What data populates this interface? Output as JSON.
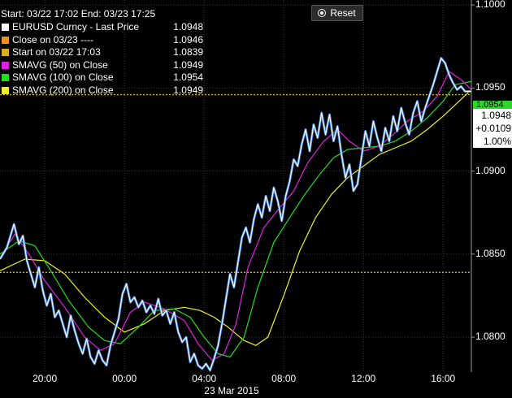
{
  "header": {
    "range_text": "Start: 03/22 17:02 End: 03/23 17:25",
    "reset_label": "Reset"
  },
  "legend": [
    {
      "label": "EURUSD Curncy - Last Price",
      "value": "1.0948",
      "color": "#ffffff"
    },
    {
      "label": "Close on 03/23 ----",
      "value": "1.0946",
      "color": "#f28c1c"
    },
    {
      "label": "Start on 03/22 17:03",
      "value": "1.0839",
      "color": "#d4b020"
    },
    {
      "label": "SMAVG (50) on Close",
      "value": "1.0949",
      "color": "#e020e0"
    },
    {
      "label": "SMAVG (100) on Close",
      "value": "1.0954",
      "color": "#20dd20"
    },
    {
      "label": "SMAVG (200) on Close",
      "value": "1.0949",
      "color": "#f0f020"
    }
  ],
  "last_price_box": {
    "ma_value": "1.0954",
    "price": "1.0948",
    "change": "+0.0109",
    "pct": "1.00%"
  },
  "chart_data": {
    "type": "line",
    "title": "",
    "xlabel": "23 Mar 2015",
    "ylabel": "",
    "x_range_hours": [
      -6.25,
      17.42
    ],
    "x_ticks": [
      {
        "label": "20:00",
        "hour": -4
      },
      {
        "label": "00:00",
        "hour": 0
      },
      {
        "label": "04:00",
        "hour": 4
      },
      {
        "label": "08:00",
        "hour": 8
      },
      {
        "label": "12:00",
        "hour": 12
      },
      {
        "label": "16:00",
        "hour": 16
      }
    ],
    "ylim": [
      1.0779,
      1.1003
    ],
    "y_ticks": [
      "1.1000",
      "1.0950",
      "1.0900",
      "1.0850",
      "1.0800"
    ],
    "reference_lines": [
      {
        "name": "Close on 03/23",
        "value": 1.0946,
        "color": "#d4b020"
      },
      {
        "name": "Start on 03/22 17:03",
        "value": 1.0839,
        "color": "#d4b020"
      }
    ],
    "series": [
      {
        "name": "EURUSD Curncy - Last Price",
        "color": "#ffffff",
        "x": [
          -6.25,
          -5.9,
          -5.7,
          -5.55,
          -5.3,
          -5.1,
          -4.9,
          -4.7,
          -4.5,
          -4.3,
          -4.1,
          -3.9,
          -3.7,
          -3.5,
          -3.3,
          -3.1,
          -2.9,
          -2.7,
          -2.5,
          -2.3,
          -2.1,
          -1.9,
          -1.7,
          -1.5,
          -1.3,
          -1.1,
          -0.9,
          -0.7,
          -0.5,
          -0.3,
          -0.1,
          0.1,
          0.3,
          0.5,
          0.7,
          0.9,
          1.1,
          1.3,
          1.5,
          1.7,
          1.9,
          2.1,
          2.3,
          2.5,
          2.7,
          2.9,
          3.1,
          3.3,
          3.5,
          3.7,
          3.9,
          4.1,
          4.3,
          4.5,
          4.7,
          4.9,
          5.1,
          5.3,
          5.5,
          5.7,
          5.9,
          6.1,
          6.3,
          6.5,
          6.7,
          6.9,
          7.1,
          7.3,
          7.5,
          7.7,
          7.9,
          8.1,
          8.3,
          8.5,
          8.7,
          8.9,
          9.1,
          9.3,
          9.5,
          9.7,
          9.9,
          10.1,
          10.3,
          10.5,
          10.7,
          10.9,
          11.1,
          11.3,
          11.5,
          11.7,
          11.9,
          12.1,
          12.3,
          12.5,
          12.7,
          12.9,
          13.1,
          13.3,
          13.5,
          13.7,
          13.9,
          14.1,
          14.3,
          14.5,
          14.7,
          14.9,
          15.1,
          15.3,
          15.5,
          15.7,
          15.9,
          16.1,
          16.3,
          16.5,
          16.7,
          16.9,
          17.1,
          17.42
        ],
        "values": [
          1.0847,
          1.0854,
          1.0862,
          1.0868,
          1.0856,
          1.0861,
          1.0846,
          1.0838,
          1.083,
          1.0842,
          1.0828,
          1.0819,
          1.0826,
          1.0812,
          1.0816,
          1.0808,
          1.08,
          1.0813,
          1.0804,
          1.0796,
          1.079,
          1.0799,
          1.0788,
          1.0784,
          1.0792,
          1.0786,
          1.0783,
          1.0795,
          1.0803,
          1.0811,
          1.0826,
          1.0832,
          1.0821,
          1.0824,
          1.0818,
          1.0822,
          1.0815,
          1.0819,
          1.0814,
          1.0823,
          1.0813,
          1.0816,
          1.0808,
          1.0815,
          1.0803,
          1.0797,
          1.08,
          1.0785,
          1.079,
          1.0783,
          1.0781,
          1.0784,
          1.078,
          1.0787,
          1.0795,
          1.0808,
          1.0823,
          1.0838,
          1.083,
          1.0845,
          1.086,
          1.0866,
          1.0857,
          1.0871,
          1.088,
          1.0872,
          1.0885,
          1.0876,
          1.089,
          1.0882,
          1.087,
          1.0885,
          1.0894,
          1.0907,
          1.0903,
          1.0916,
          1.0925,
          1.0912,
          1.0928,
          1.092,
          1.0935,
          1.0922,
          1.0934,
          1.0918,
          1.0927,
          1.091,
          1.0896,
          1.0904,
          1.0888,
          1.0892,
          1.0908,
          1.0924,
          1.0915,
          1.093,
          1.092,
          1.0912,
          1.0926,
          1.0918,
          1.0933,
          1.0924,
          1.0938,
          1.0929,
          1.0922,
          1.0935,
          1.0942,
          1.093,
          1.0938,
          1.0945,
          1.0952,
          1.096,
          1.0968,
          1.0965,
          1.0958,
          1.0953,
          1.0949,
          1.0951,
          1.0948,
          1.0948
        ]
      },
      {
        "name": "SMAVG (50) on Close",
        "color": "#e020e0",
        "x": [
          -6.25,
          -5.5,
          -4.8,
          -4,
          -3,
          -2,
          -1.2,
          -0.5,
          0.3,
          1,
          2,
          3,
          3.7,
          4.4,
          5,
          5.6,
          6.2,
          7,
          7.8,
          8.5,
          9.2,
          10,
          10.7,
          11.3,
          12,
          12.8,
          13.5,
          14.2,
          15,
          15.7,
          16.3,
          16.9,
          17.42
        ],
        "values": [
          1.0848,
          1.0862,
          1.085,
          1.0834,
          1.0818,
          1.08,
          1.0792,
          1.0796,
          1.0815,
          1.0821,
          1.0817,
          1.081,
          1.0796,
          1.0786,
          1.079,
          1.0808,
          1.0842,
          1.0866,
          1.0878,
          1.0888,
          1.0905,
          1.0918,
          1.0925,
          1.0918,
          1.0912,
          1.0915,
          1.0922,
          1.093,
          1.0936,
          1.0945,
          1.096,
          1.0955,
          1.0949
        ]
      },
      {
        "name": "SMAVG (100) on Close",
        "color": "#20dd20",
        "x": [
          -6.25,
          -5.3,
          -4.5,
          -3.7,
          -2.8,
          -1.8,
          -1,
          -0.2,
          0.7,
          1.5,
          2.5,
          3.3,
          4,
          4.7,
          5.3,
          6,
          6.7,
          7.5,
          8.3,
          9,
          9.8,
          10.5,
          11.2,
          12,
          12.8,
          13.6,
          14.4,
          15.2,
          16,
          16.6,
          17.42
        ],
        "values": [
          1.085,
          1.0858,
          1.0855,
          1.084,
          1.0822,
          1.0806,
          1.0798,
          1.0796,
          1.0806,
          1.0816,
          1.0817,
          1.0812,
          1.08,
          1.079,
          1.0788,
          1.08,
          1.083,
          1.0857,
          1.0872,
          1.0885,
          1.0898,
          1.0908,
          1.0913,
          1.0914,
          1.0915,
          1.0918,
          1.0924,
          1.0932,
          1.0942,
          1.0952,
          1.0954
        ]
      },
      {
        "name": "SMAVG (200) on Close",
        "color": "#f0f020",
        "x": [
          -6.25,
          -5,
          -4,
          -3,
          -2,
          -1,
          0,
          1,
          2,
          3,
          3.8,
          4.5,
          5.2,
          6,
          6.6,
          7.2,
          8,
          8.8,
          9.6,
          10.4,
          11.2,
          12,
          12.8,
          13.6,
          14.4,
          15.2,
          16,
          16.8,
          17.42
        ],
        "values": [
          1.084,
          1.0847,
          1.0846,
          1.0838,
          1.0824,
          1.0812,
          1.0803,
          1.0808,
          1.0816,
          1.0818,
          1.0816,
          1.0812,
          1.0806,
          1.0798,
          1.0795,
          1.08,
          1.0825,
          1.0852,
          1.0872,
          1.0886,
          1.0896,
          1.0903,
          1.091,
          1.0914,
          1.0918,
          1.0925,
          1.0933,
          1.0942,
          1.0949
        ]
      }
    ]
  }
}
